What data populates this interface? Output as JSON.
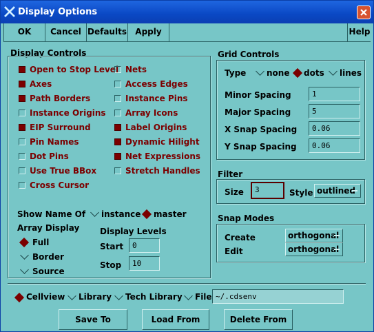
{
  "window": {
    "title": "Display Options"
  },
  "toolbar": {
    "ok": "OK",
    "cancel": "Cancel",
    "defaults": "Defaults",
    "apply": "Apply",
    "help": "Help"
  },
  "display_controls": {
    "title": "Display Controls",
    "left": [
      {
        "label": "Open to Stop Level",
        "checked": true
      },
      {
        "label": "Axes",
        "checked": true
      },
      {
        "label": "Path Borders",
        "checked": true
      },
      {
        "label": "Instance Origins",
        "checked": false
      },
      {
        "label": "EIP Surround",
        "checked": true
      },
      {
        "label": "Pin Names",
        "checked": false
      },
      {
        "label": "Dot Pins",
        "checked": false
      },
      {
        "label": "Use True BBox",
        "checked": false
      },
      {
        "label": "Cross Cursor",
        "checked": false
      }
    ],
    "right": [
      {
        "label": "Nets",
        "checked": false
      },
      {
        "label": "Access Edges",
        "checked": false
      },
      {
        "label": "Instance Pins",
        "checked": false
      },
      {
        "label": "Array Icons",
        "checked": false
      },
      {
        "label": "Label Origins",
        "checked": true
      },
      {
        "label": "Dynamic Hilight",
        "checked": true
      },
      {
        "label": "Net Expressions",
        "checked": true
      },
      {
        "label": "Stretch Handles",
        "checked": false
      }
    ],
    "show_name_of": {
      "label": "Show Name Of",
      "options": [
        "instance",
        "master"
      ],
      "selected": "master"
    },
    "array_display": {
      "label": "Array Display",
      "options": [
        "Full",
        "Border",
        "Source"
      ],
      "selected": "Full"
    },
    "display_levels": {
      "label": "Display Levels",
      "start_label": "Start",
      "start": "0",
      "stop_label": "Stop",
      "stop": "10"
    }
  },
  "grid_controls": {
    "title": "Grid Controls",
    "type_label": "Type",
    "type_options": [
      "none",
      "dots",
      "lines"
    ],
    "type_selected": "dots",
    "minor_label": "Minor Spacing",
    "minor": "1",
    "major_label": "Major Spacing",
    "major": "5",
    "xsnap_label": "X Snap Spacing",
    "xsnap": "0.06",
    "ysnap_label": "Y Snap Spacing",
    "ysnap": "0.06"
  },
  "filter": {
    "title": "Filter",
    "size_label": "Size",
    "size": "3",
    "style_label": "Style",
    "style": "outlined"
  },
  "snap_modes": {
    "title": "Snap Modes",
    "create_label": "Create",
    "create": "orthogonal",
    "edit_label": "Edit",
    "edit": "orthogonal"
  },
  "source": {
    "options": [
      "Cellview",
      "Library",
      "Tech Library",
      "File"
    ],
    "selected": "Cellview",
    "file_path": "~/.cdsenv"
  },
  "actions": {
    "save_to": "Save To",
    "load_from": "Load From",
    "delete_from": "Delete From"
  },
  "colors": {
    "bg": "#77c6c7",
    "title_bar": "#0a48c4",
    "accent": "#7b0000"
  }
}
